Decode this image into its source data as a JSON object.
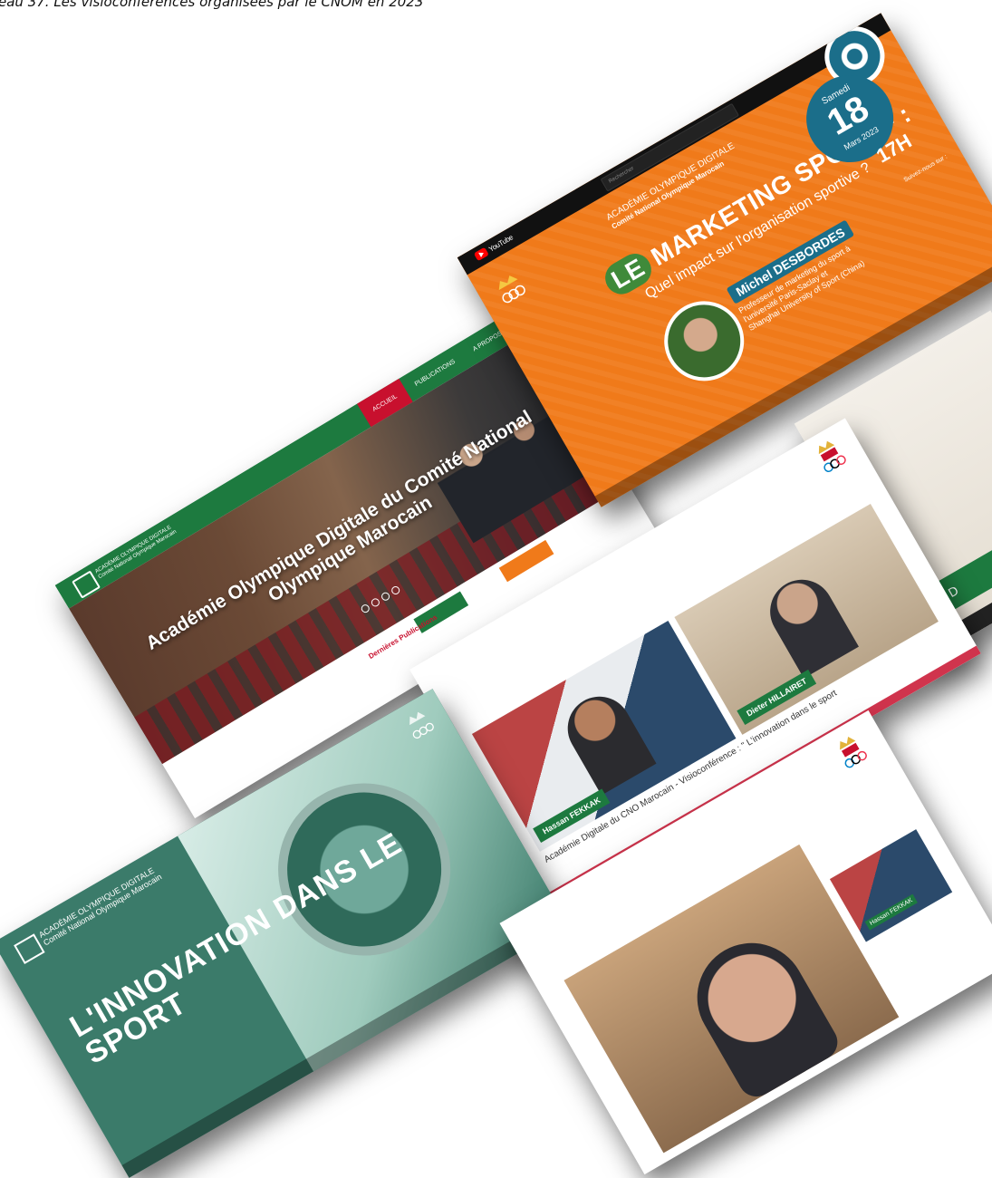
{
  "caption": "eau 37. Les visioconférences organisées par le CNOM en 2023",
  "website": {
    "nav": [
      "ACCUEIL",
      "PUBLICATIONS",
      "A PROPOS"
    ],
    "hero_title": "Académie Olympique Digitale du Comité National Olympique Marocain",
    "latest_label": "Dernières Publications"
  },
  "youtube_card": {
    "brand": "YouTube",
    "search_placeholder": "Rechercher",
    "academy_line1": "ACADÉMIE OLYMPIQUE DIGITALE",
    "academy_line2": "Comité National Olympique Marocain",
    "title_le": "LE",
    "title_main": "MARKETING SPORTIF :",
    "subtitle": "Quel impact sur l'organisation sportive ?",
    "day_name": "Samedi",
    "day_number": "18",
    "month_year": "Mars 2023",
    "hour": "17H",
    "speaker_name": "Michel DESBORDES",
    "speaker_title_1": "Professeur de marketing du sport à",
    "speaker_title_2": "l'université Paris-Saclay et",
    "speaker_title_3": "Shanghai University of Sport (China)",
    "follow_label": "Suivez-nous sur :"
  },
  "right_card": {
    "name_band": "Michel D"
  },
  "video_card": {
    "speaker1": "Hassan FEKKAK",
    "speaker2": "Dieter HILLAIRET",
    "video_title": "Académie Digitale du CNO Marocain - Visioconférence : \" L'innovation dans le sport"
  },
  "innovation_card": {
    "academy_line1": "ACADÉMIE OLYMPIQUE DIGITALE",
    "academy_line2": "Comité National Olympique Marocain",
    "title": "L'INNOVATION DANS LE SPORT"
  },
  "closeup_card": {
    "pip_label": "Hassan FEKKAK"
  },
  "colors": {
    "green": "#1d7a3f",
    "red": "#c8102e",
    "orange": "#f07a1a",
    "teal": "#1b6e8a"
  }
}
